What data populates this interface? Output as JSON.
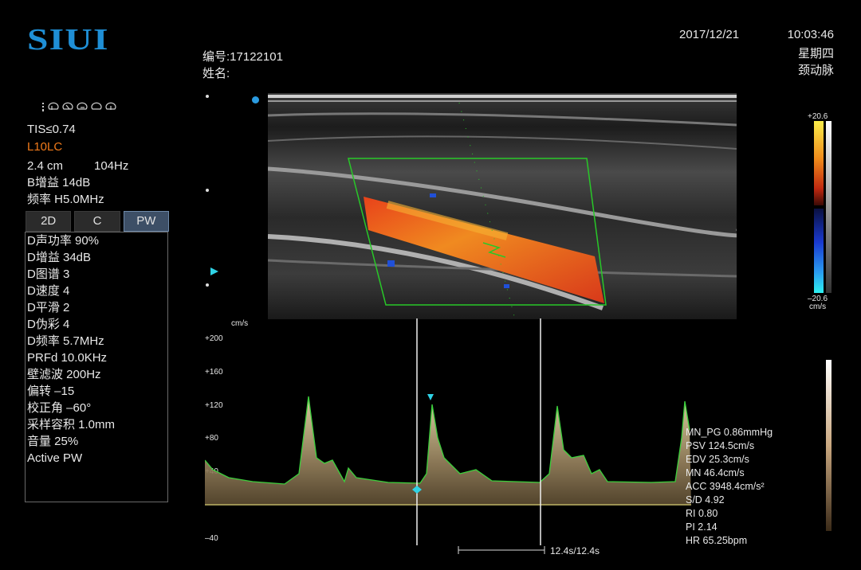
{
  "brand": {
    "logo_text": "SIUI"
  },
  "header": {
    "id_label": "编号:17122101",
    "name_label": "姓名:",
    "date": "2017/12/21",
    "time": "10:03:46",
    "weekday": "星期四",
    "exam": "颈动脉"
  },
  "status_icons": [
    "signal-bars-icon",
    "probe-icon",
    "probe-icon",
    "probe-icon",
    "probe-icon",
    "probe-icon"
  ],
  "info": {
    "tis": "TIS≤0.74",
    "probe": "L10LC",
    "depth": "2.4 cm",
    "frame_rate": "104Hz",
    "b_gain": "B增益 14dB",
    "freq": "频率 H5.0MHz"
  },
  "mode_tabs": [
    {
      "label": "2D",
      "active": false
    },
    {
      "label": "C",
      "active": false
    },
    {
      "label": "PW",
      "active": true
    }
  ],
  "pw_params": [
    "D声功率 90%",
    "D增益 34dB",
    "D图谱 3",
    "D速度 4",
    "D平滑 2",
    "D伪彩 4",
    "D频率 5.7MHz",
    "PRFd 10.0KHz",
    "壁滤波 200Hz",
    "偏转 –15",
    "校正角 –60°",
    "采样容积 1.0mm",
    "音量 25%",
    "Active PW"
  ],
  "color_scale": {
    "top": "+20.6",
    "bottom": "–20.6",
    "unit": "cm/s"
  },
  "spectrum": {
    "unit": "cm/s",
    "ticks": [
      "+200",
      "+160",
      "+120",
      "+80",
      "+40",
      "–40"
    ],
    "time_label": "12.4s/12.4s"
  },
  "measurements": [
    "MN_PG 0.86mmHg",
    "PSV 124.5cm/s",
    "EDV 25.3cm/s",
    "MN 46.4cm/s",
    "ACC 3948.4cm/s²",
    "S/D 4.92",
    "RI 0.80",
    "PI 2.14",
    "HR 65.25bpm"
  ],
  "colors": {
    "brand": "#1f8fd6",
    "probe_text": "#f07a1a",
    "roi_box": "#28c828",
    "trace": "#3ccf3c",
    "marker": "#2fd3e6",
    "baseline": "#e6e07a"
  }
}
